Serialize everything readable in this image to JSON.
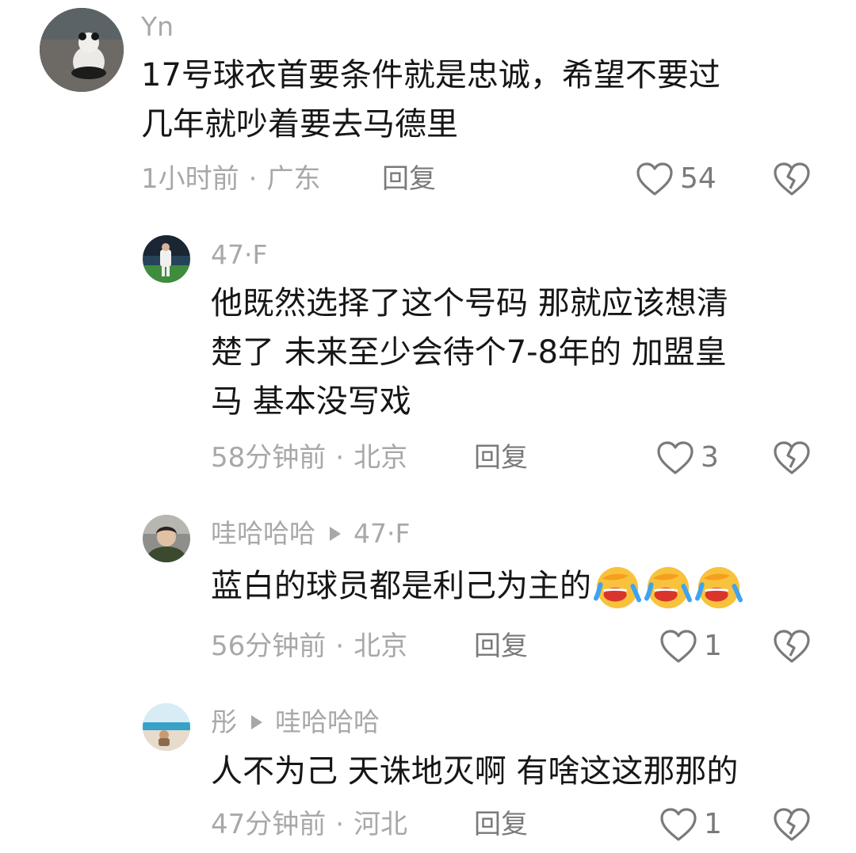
{
  "comments": [
    {
      "username": "Yn",
      "text_line1": "17号球衣首要条件就是忠诚，希望不要过",
      "text_line2": "几年就吵着要去马德里",
      "time": "1小时前",
      "location": "广东",
      "reply_label": "回复",
      "likes": "54"
    },
    {
      "username": "47·F",
      "text_line1": "他既然选择了这个号码 那就应该想清",
      "text_line2": "楚了 未来至少会待个7-8年的 加盟皇",
      "text_line3": "马 基本没写戏",
      "time": "58分钟前",
      "location": "北京",
      "reply_label": "回复",
      "likes": "3"
    },
    {
      "username": "哇哈哈哈",
      "reply_to": "47·F",
      "text_line1": "蓝白的球员都是利己为主的",
      "emoji_name": "rolling-laughing-crying-emoji",
      "time": "56分钟前",
      "location": "北京",
      "reply_label": "回复",
      "likes": "1"
    },
    {
      "username": "彤",
      "reply_to": "哇哈哈哈",
      "text_line1": "人不为己 天诛地灭啊 有啥这这那那的",
      "time": "47分钟前",
      "location": "河北",
      "reply_label": "回复",
      "likes": "1"
    }
  ],
  "separator": "·",
  "icons": {
    "like": "heart-outline-icon",
    "dislike": "broken-heart-icon",
    "reply_arrow": "triangle-right-icon"
  }
}
